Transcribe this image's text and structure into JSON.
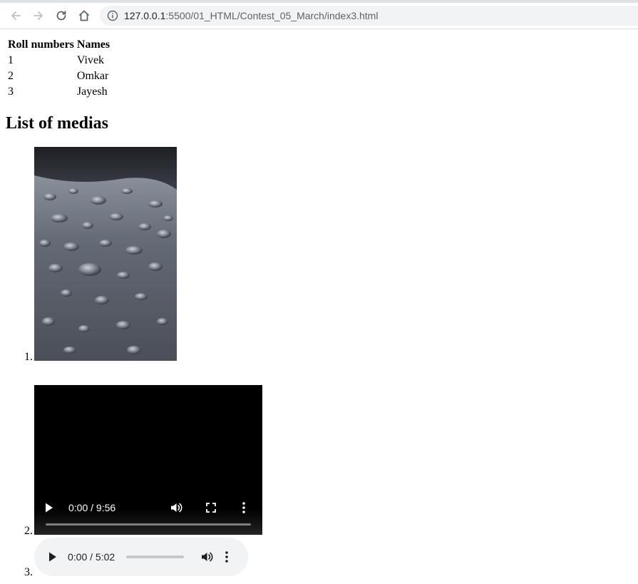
{
  "browser": {
    "url_host": "127.0.0.1",
    "url_rest": ":5500/01_HTML/Contest_05_March/index3.html",
    "nav_icons": [
      "back-arrow-icon",
      "forward-arrow-icon",
      "reload-icon",
      "home-icon",
      "info-icon"
    ]
  },
  "table": {
    "headers": [
      "Roll numbers",
      "Names"
    ],
    "rows": [
      [
        "1",
        "Vivek"
      ],
      [
        "2",
        "Omkar"
      ],
      [
        "3",
        "Jayesh"
      ]
    ]
  },
  "media": {
    "heading": "List of medias",
    "markers": [
      "1.",
      "2.",
      "3."
    ],
    "video": {
      "time": "0:00 / 9:56",
      "progress": 0
    },
    "audio": {
      "time": "0:00 / 5:02",
      "progress": 0
    }
  },
  "colors": {
    "omnibox_bg": "#f1f3f4",
    "video_bg": "#000000",
    "audio_bg": "#f1f3f4",
    "toolbar_icon": "#5f6368"
  }
}
